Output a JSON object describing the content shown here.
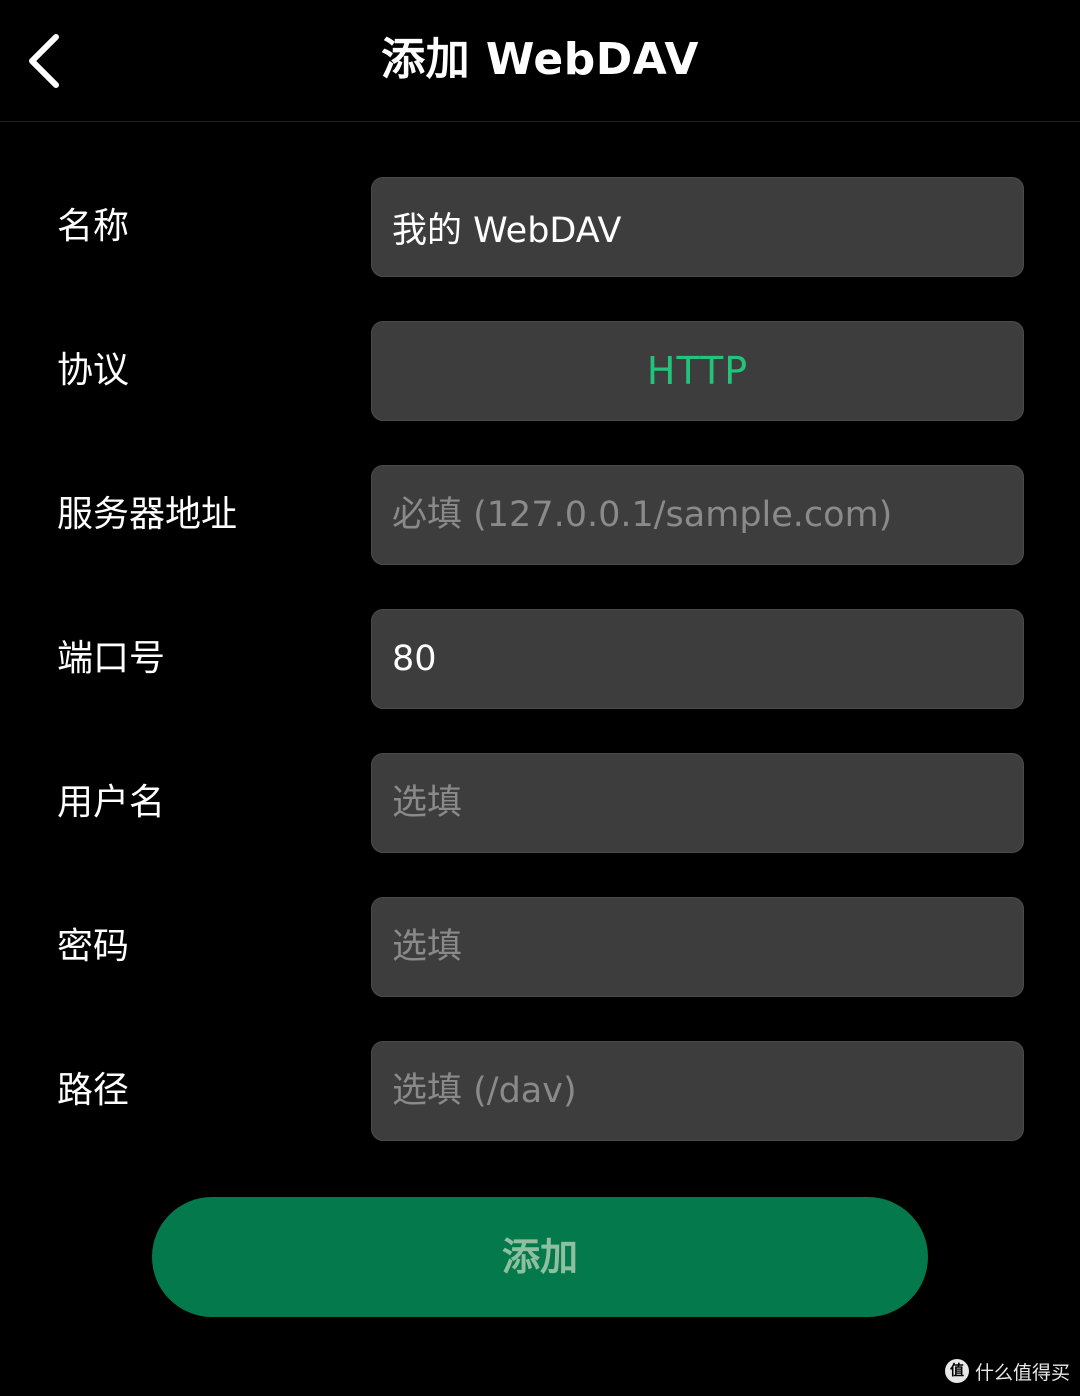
{
  "header": {
    "title": "添加 WebDAV"
  },
  "form": {
    "name": {
      "label": "名称",
      "value": "我的 WebDAV"
    },
    "protocol": {
      "label": "协议",
      "value": "HTTP",
      "color": "#22c37a"
    },
    "server": {
      "label": "服务器地址",
      "placeholder": "必填 (127.0.0.1/sample.com)"
    },
    "port": {
      "label": "端口号",
      "value": "80"
    },
    "username": {
      "label": "用户名",
      "placeholder": "选填"
    },
    "password": {
      "label": "密码",
      "placeholder": "选填"
    },
    "path": {
      "label": "路径",
      "placeholder": "选填 (/dav)"
    }
  },
  "submit": {
    "label": "添加",
    "color": "#047a4c"
  },
  "watermark": {
    "logo_text": "值",
    "text": "什么值得买"
  },
  "icons": {
    "back": "chevron-left-icon"
  }
}
